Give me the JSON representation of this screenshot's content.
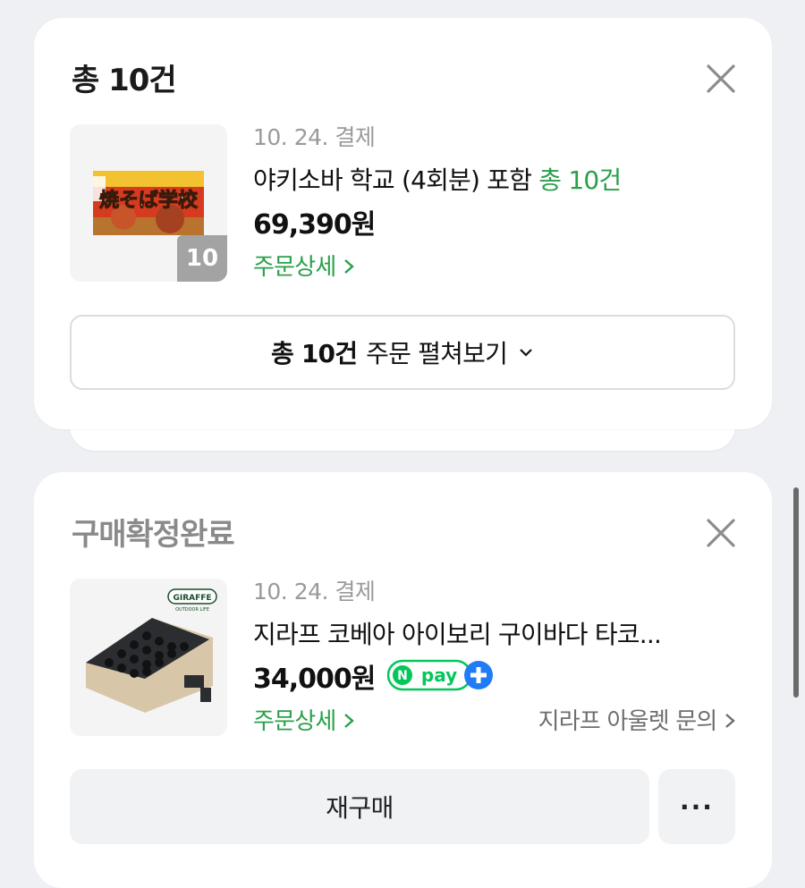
{
  "order1": {
    "title": "총 10건",
    "date": "10. 24. 결제",
    "product_name": "야키소바 학교 (4회분) 포함",
    "product_suffix": "총 10건",
    "price": "69,390원",
    "detail_link": "주문상세",
    "item_count": "10",
    "product_image_text": "焼そば学校",
    "expand_bold": "총 10건",
    "expand_rest": "주문 펼쳐보기"
  },
  "order2": {
    "status": "구매확정완료",
    "date": "10. 24. 결제",
    "product_name": "지라프 코베아 아이보리 구이바다 타코...",
    "price": "34,000원",
    "npay_label": "pay",
    "npay_n": "N",
    "detail_link": "주문상세",
    "store_link": "지라프 아울렛 문의",
    "brand_logo": "GIRAFFE",
    "brand_sub": "OUTDOOR LIFE",
    "rebuy_label": "재구매",
    "more_label": "···"
  },
  "colors": {
    "accent_green": "#29a04a",
    "npay_green": "#03c75a",
    "npay_blue": "#1f7cf5",
    "background": "#eef0f3"
  },
  "icons": [
    "close-icon",
    "chevron-right-icon",
    "chevron-down-icon",
    "npay-logo",
    "plus-icon"
  ]
}
